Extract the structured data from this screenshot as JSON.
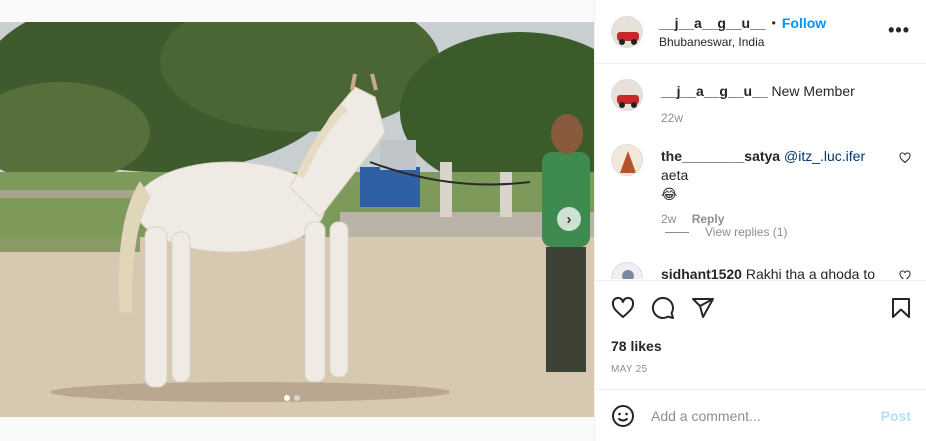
{
  "post": {
    "author": "__j__a__g__u__",
    "follow_label": "Follow",
    "separator": "•",
    "location": "Bhubaneswar, India",
    "more_icon": "more-horizontal-icon",
    "likes": "78 likes",
    "date": "MAY 25",
    "carousel": {
      "slides": 2,
      "active_index": 0,
      "next_icon": "chevron-right-icon",
      "next_glyph": "›"
    }
  },
  "caption": {
    "user": "__j__a__g__u__",
    "text": "New Member",
    "age": "22w"
  },
  "comments": [
    {
      "user": "the________satya",
      "mention": "@itz_.luc.ifer",
      "text": "aeta",
      "emoji": "😂",
      "age": "2w",
      "reply_label": "Reply",
      "view_replies_label": "View replies (1)"
    },
    {
      "user": "sidhant1520",
      "text": "Rakhi tha a ghoda to"
    }
  ],
  "actions": {
    "like_icon": "heart-icon",
    "comment_icon": "comment-icon",
    "share_icon": "send-icon",
    "save_icon": "bookmark-icon"
  },
  "add_comment": {
    "emoji_icon": "smiley-icon",
    "placeholder": "Add a comment...",
    "post_label": "Post"
  },
  "colors": {
    "accent": "#0095f6",
    "post_disabled": "#b2dffc",
    "muted": "#8e8e8e",
    "mention": "#00376b"
  }
}
